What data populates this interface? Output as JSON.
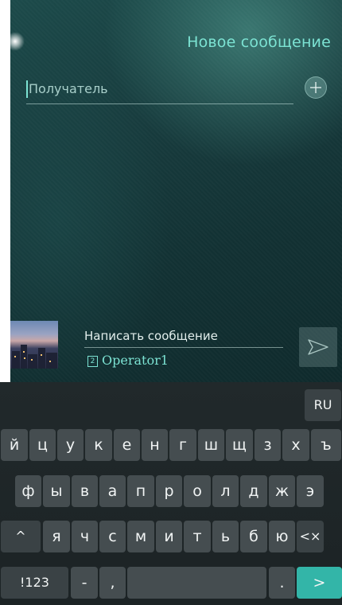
{
  "header": {
    "title": "Новое сообщение"
  },
  "recipient": {
    "placeholder": "Получатель",
    "add_contact_icon": "plus-icon"
  },
  "compose": {
    "placeholder": "Написать сообщение",
    "sim_slot": "2",
    "sim_operator": "Operator1",
    "send_icon": "send-arrow-icon"
  },
  "keyboard": {
    "language_label": "RU",
    "row1": [
      "й",
      "ц",
      "у",
      "к",
      "е",
      "н",
      "г",
      "ш",
      "щ",
      "з",
      "х",
      "ъ"
    ],
    "row2": [
      "ф",
      "ы",
      "в",
      "а",
      "п",
      "р",
      "о",
      "л",
      "д",
      "ж",
      "э"
    ],
    "row3": [
      "^",
      "я",
      "ч",
      "с",
      "м",
      "и",
      "т",
      "ь",
      "б",
      "ю",
      "<×"
    ],
    "row4": [
      "!123",
      "-",
      ",",
      "",
      ".",
      ">"
    ]
  },
  "colors": {
    "accent": "#7ce3d3",
    "keyboard_bg": "#21292b",
    "key_bg": "#454d50",
    "go_key": "#33b5a8"
  }
}
